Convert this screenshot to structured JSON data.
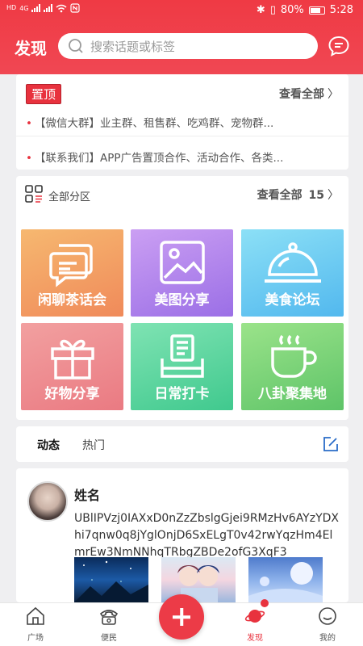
{
  "status_bar": {
    "left_labels": [
      "HD",
      "HD"
    ],
    "network": "4G",
    "battery": "80%",
    "time": "5:28"
  },
  "header": {
    "title": "发现",
    "search_placeholder": "搜索话题或标签"
  },
  "pinned": {
    "badge": "置顶",
    "see_all": "查看全部",
    "items": [
      "【微信大群】业主群、租售群、吃鸡群、宠物群...",
      "【联系我们】APP广告置顶合作、活动合作、各类..."
    ]
  },
  "categories": {
    "header_label": "全部分区",
    "see_all": "查看全部",
    "count": "15",
    "tiles": [
      {
        "label": "闲聊茶话会",
        "color_top": "#f6b870",
        "color_bottom": "#f08a5a",
        "icon": "chat-bubbles-icon"
      },
      {
        "label": "美图分享",
        "color_top": "#cb9ff3",
        "color_bottom": "#9b6fe6",
        "icon": "image-icon"
      },
      {
        "label": "美食论坛",
        "color_top": "#8ce0f6",
        "color_bottom": "#52b8ee",
        "icon": "dish-cover-icon"
      },
      {
        "label": "好物分享",
        "color_top": "#f2a0a0",
        "color_bottom": "#ea7a82",
        "icon": "gift-icon"
      },
      {
        "label": "日常打卡",
        "color_top": "#7fe3b3",
        "color_bottom": "#40c98e",
        "icon": "check-in-icon"
      },
      {
        "label": "八卦聚集地",
        "color_top": "#9be38a",
        "color_bottom": "#5ec468",
        "icon": "coffee-cup-icon"
      }
    ]
  },
  "feed_tabs": {
    "tabs": [
      "动态",
      "热门"
    ],
    "active": "动态"
  },
  "post": {
    "author": "姓名",
    "text": "UBlIPVzj0IAXxD0nZzZbslgGjei9RMzHv6AYzYDXhi7qnw0q8jYglOnjD6SxELgT0v42rwYqzHm4ElmrEw3NmNNhqTRbgZBDe2ofG3XqF3"
  },
  "bottom_nav": {
    "items": [
      {
        "label": "广场",
        "icon": "home-icon"
      },
      {
        "label": "便民",
        "icon": "phone-icon"
      },
      {
        "label": "发现",
        "icon": "planet-icon"
      },
      {
        "label": "我的",
        "icon": "user-icon"
      }
    ],
    "active": "发现"
  },
  "colors": {
    "brand_red": "#ec3b47",
    "background": "#efeff1"
  }
}
